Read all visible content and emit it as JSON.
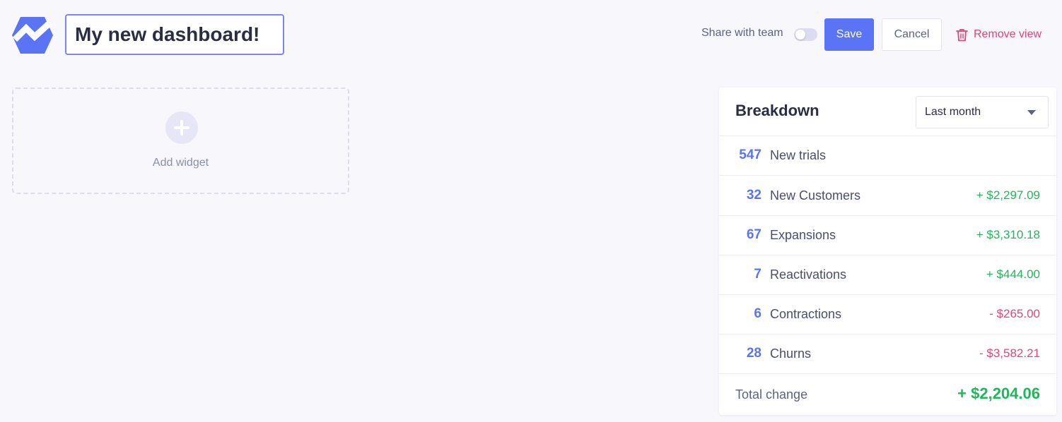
{
  "app": {
    "logo_icon": "baremetrics-logo-icon",
    "dashboard_title": "My new dashboard!"
  },
  "toolbar": {
    "share_label": "Share with team",
    "share_enabled": false,
    "save_label": "Save",
    "cancel_label": "Cancel",
    "remove_label": "Remove view",
    "remove_icon": "trash-icon"
  },
  "widget_area": {
    "add_label": "Add widget",
    "add_icon": "plus-icon"
  },
  "breakdown": {
    "title": "Breakdown",
    "period": "Last month",
    "rows": [
      {
        "count": "547",
        "label": "New trials",
        "amount": "",
        "sign": ""
      },
      {
        "count": "32",
        "label": "New Customers",
        "amount": "+ $2,297.09",
        "sign": "pos"
      },
      {
        "count": "67",
        "label": "Expansions",
        "amount": "+ $3,310.18",
        "sign": "pos"
      },
      {
        "count": "7",
        "label": "Reactivations",
        "amount": "+ $444.00",
        "sign": "pos"
      },
      {
        "count": "6",
        "label": "Contractions",
        "amount": "- $265.00",
        "sign": "neg"
      },
      {
        "count": "28",
        "label": "Churns",
        "amount": "- $3,582.21",
        "sign": "neg"
      }
    ],
    "total_label": "Total change",
    "total_amount": "+ $2,204.06"
  },
  "colors": {
    "accent": "#5b74f5",
    "positive": "#1fb75a",
    "negative": "#e0457b",
    "background": "#f7f7fc"
  }
}
